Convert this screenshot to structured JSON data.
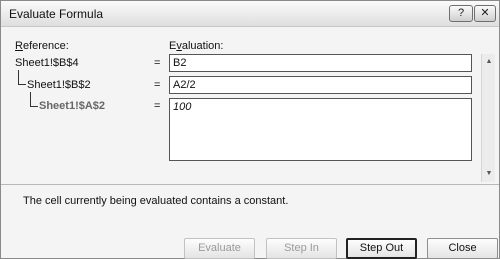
{
  "window": {
    "title": "Evaluate Formula",
    "help_label": "?",
    "close_glyph": "✕"
  },
  "headers": {
    "reference": "Reference:",
    "evaluation": "Evaluation:"
  },
  "rows": [
    {
      "reference": "Sheet1!$B$4",
      "equals": "=",
      "value": "B2"
    },
    {
      "reference": "Sheet1!$B$2",
      "equals": "=",
      "value": "A2/2"
    },
    {
      "reference": "Sheet1!$A$2",
      "equals": "=",
      "value": "100"
    }
  ],
  "scrollbar": {
    "up_glyph": "▲",
    "down_glyph": "▼"
  },
  "status": "The cell currently being evaluated contains a constant.",
  "buttons": {
    "evaluate": "Evaluate",
    "step_in": "Step In",
    "step_out": "Step Out",
    "close": "Close"
  }
}
